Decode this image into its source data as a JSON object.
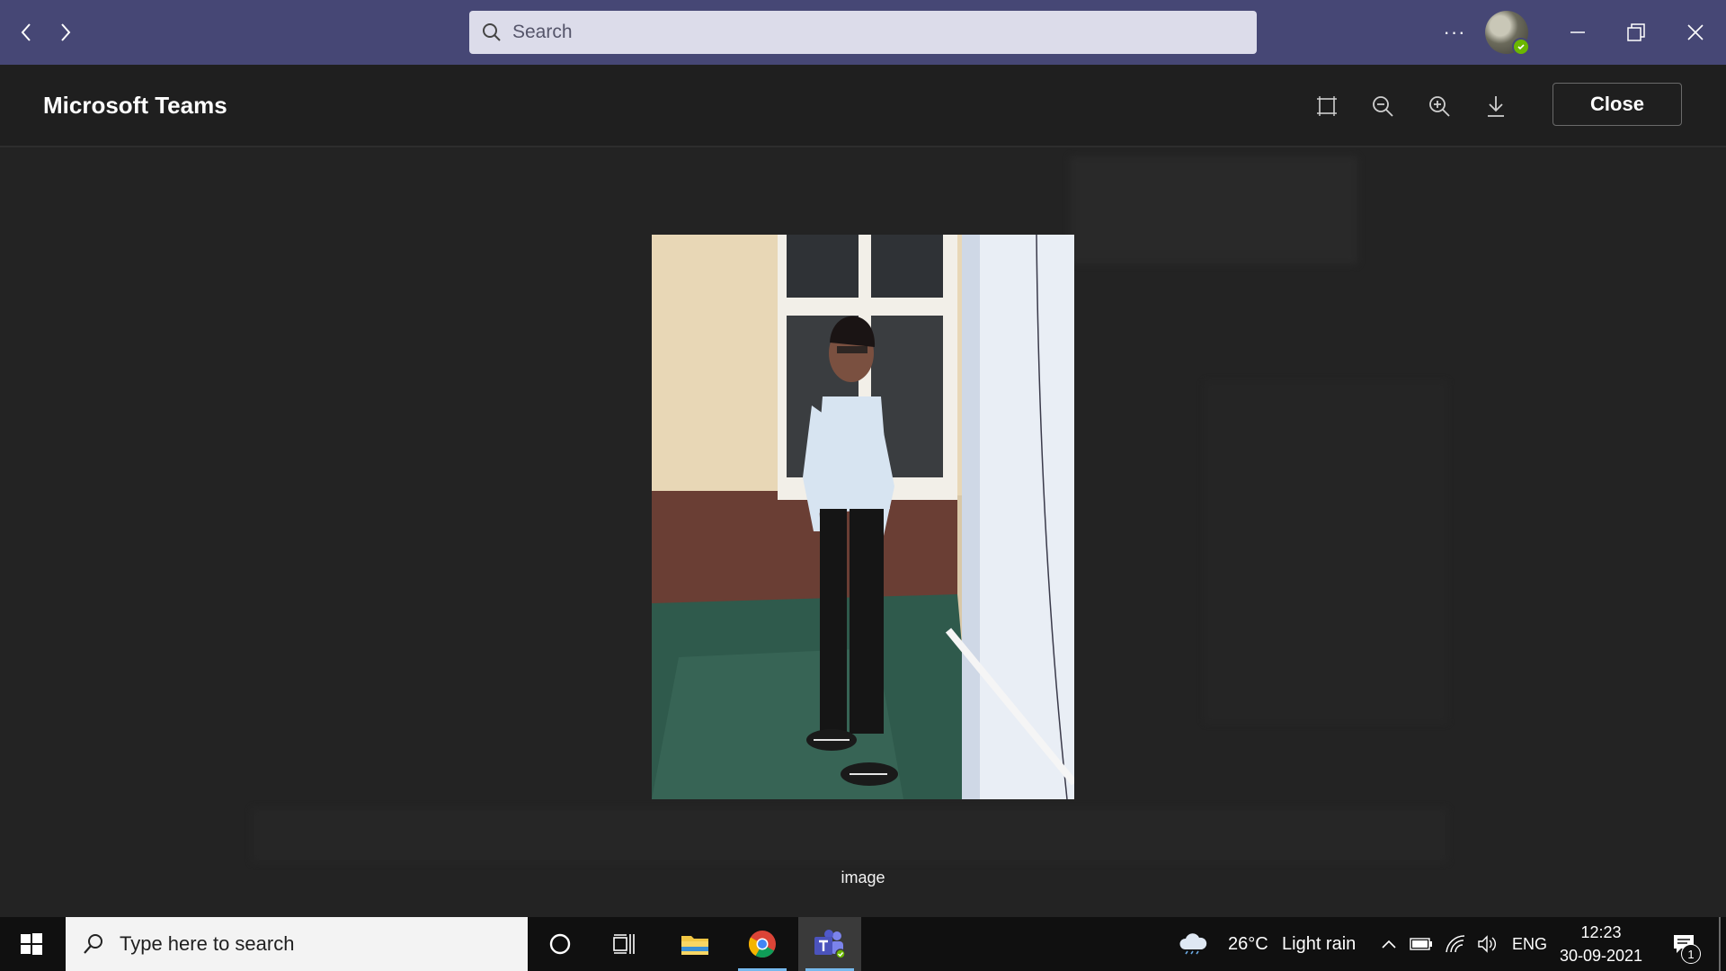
{
  "titlebar": {
    "search_placeholder": "Search",
    "back_icon": "chevron-left-icon",
    "forward_icon": "chevron-right-icon",
    "more_label": "···"
  },
  "viewer": {
    "app_title": "Microsoft Teams",
    "tools": [
      "fit-to-screen-icon",
      "zoom-out-icon",
      "zoom-in-icon",
      "download-icon"
    ],
    "close_label": "Close",
    "caption": "image"
  },
  "taskbar": {
    "search_placeholder": "Type here to search",
    "weather_temp": "26°C",
    "weather_desc": "Light rain",
    "language": "ENG",
    "time": "12:23",
    "date": "30-09-2021",
    "notification_count": "1"
  },
  "colors": {
    "titlebar_bg": "#464775",
    "viewer_bg": "#1f1f1f",
    "taskbar_bg": "#101010",
    "presence_available": "#6bb700"
  }
}
